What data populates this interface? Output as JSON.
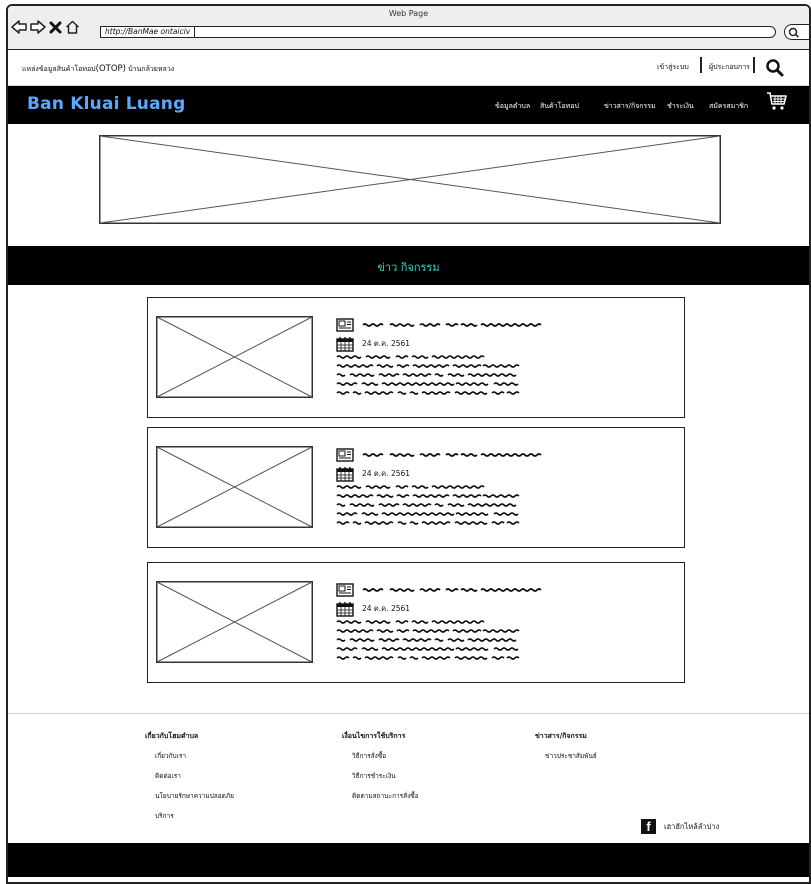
{
  "browser": {
    "window_title": "Web Page",
    "url": "http://BanMae ontaiciv"
  },
  "topbar": {
    "tagline_prefix": "แหล่งข้อมูลสินค้าโอทอป",
    "tagline_otop": "(OTOP)",
    "tagline_suffix": " บ้านกล้วยหลวง",
    "login": "เข้าสู่ระบบ",
    "admin": "ผู้ประกอบการ"
  },
  "nav": {
    "brand": "Ban Kluai Luang",
    "items": [
      "ข้อมูลตำบล",
      "สินค้าโอทอป",
      "ข่าวสาร/กิจกรรม",
      "ชำระเงิน",
      "สมัครสมาชิก"
    ]
  },
  "section": {
    "title": "ข่าว กิจกรรม"
  },
  "news": [
    {
      "date": "24 ต.ค. 2561"
    },
    {
      "date": "24 ต.ค. 2561"
    },
    {
      "date": "24 ต.ค. 2561"
    }
  ],
  "footer": {
    "columns": [
      {
        "heading": "เกี่ยวกับโฮมตำบล",
        "links": [
          "เกี่ยวกับเรา",
          "ติดต่อเรา",
          "นโยบายรักษาความปลอดภัย",
          "บริการ"
        ]
      },
      {
        "heading": "เงื่อนไขการใช้บริการ",
        "links": [
          "วิธีการสั่งซื้อ",
          "วิธีการชำระเงิน",
          "ติดตามสถานะการสั่งซื้อ"
        ]
      },
      {
        "heading": "ข่าวสาร/กิจกรรม",
        "links": [
          "ข่าวประชาสัมพันธ์"
        ]
      }
    ],
    "facebook_label": "เฮาฮักไหล้ลำปาง"
  },
  "colors": {
    "brand": "#5aa8ff",
    "section_title": "#31d6c8",
    "bars": "#000000"
  },
  "icons": [
    "back-arrow-icon",
    "forward-arrow-icon",
    "close-icon",
    "home-icon",
    "search-icon",
    "cart-icon",
    "news-icon",
    "calendar-icon",
    "facebook-icon"
  ]
}
